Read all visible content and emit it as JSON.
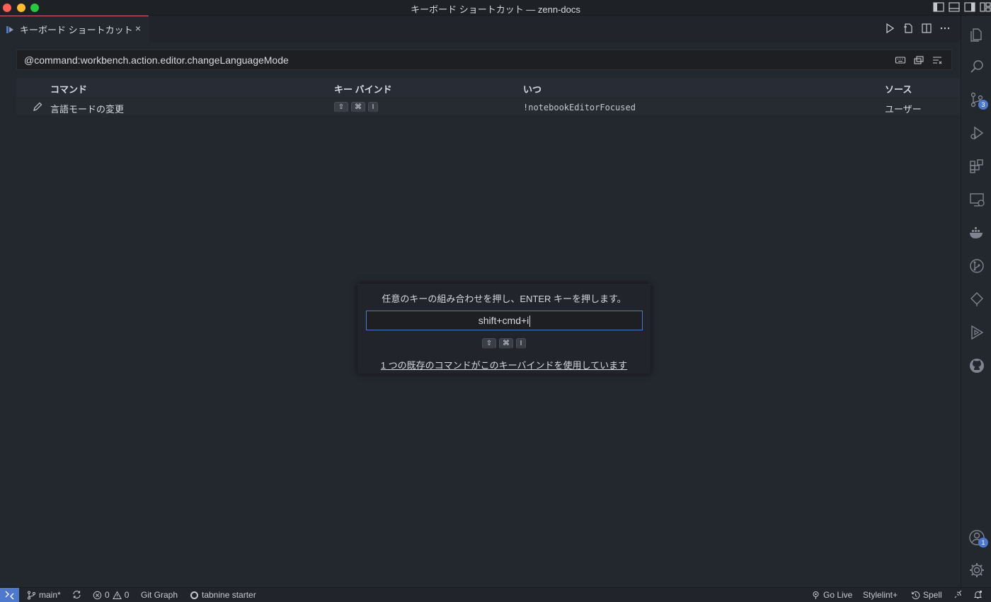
{
  "window": {
    "title": "キーボード ショートカット — zenn-docs"
  },
  "tab": {
    "label": "キーボード ショートカット",
    "close": "×"
  },
  "search": {
    "value": "@command:workbench.action.editor.changeLanguageMode"
  },
  "table": {
    "headers": {
      "command": "コマンド",
      "keybinding": "キー バインド",
      "when": "いつ",
      "source": "ソース"
    },
    "rows": [
      {
        "command": "言語モードの変更",
        "keys": [
          "⇧",
          "⌘",
          "I"
        ],
        "when": "!notebookEditorFocused",
        "source": "ユーザー"
      }
    ]
  },
  "dialog": {
    "message": "任意のキーの組み合わせを押し、ENTER キーを押します。",
    "input_value": "shift+cmd+i",
    "keys": [
      "⇧",
      "⌘",
      "I"
    ],
    "conflict_link": "1 つの既存のコマンドがこのキーバインドを使用しています"
  },
  "activity": {
    "source_control_badge": "3",
    "accounts_badge": "1"
  },
  "status": {
    "branch": "main*",
    "errors": "0",
    "warnings": "0",
    "git_graph": "Git Graph",
    "tabnine": "tabnine starter",
    "go_live": "Go Live",
    "stylelint": "Stylelint+",
    "spell": "Spell"
  },
  "colors": {
    "accent": "#4d78cc",
    "tab_border": "#e06c75",
    "editor_bg": "#23272e"
  }
}
